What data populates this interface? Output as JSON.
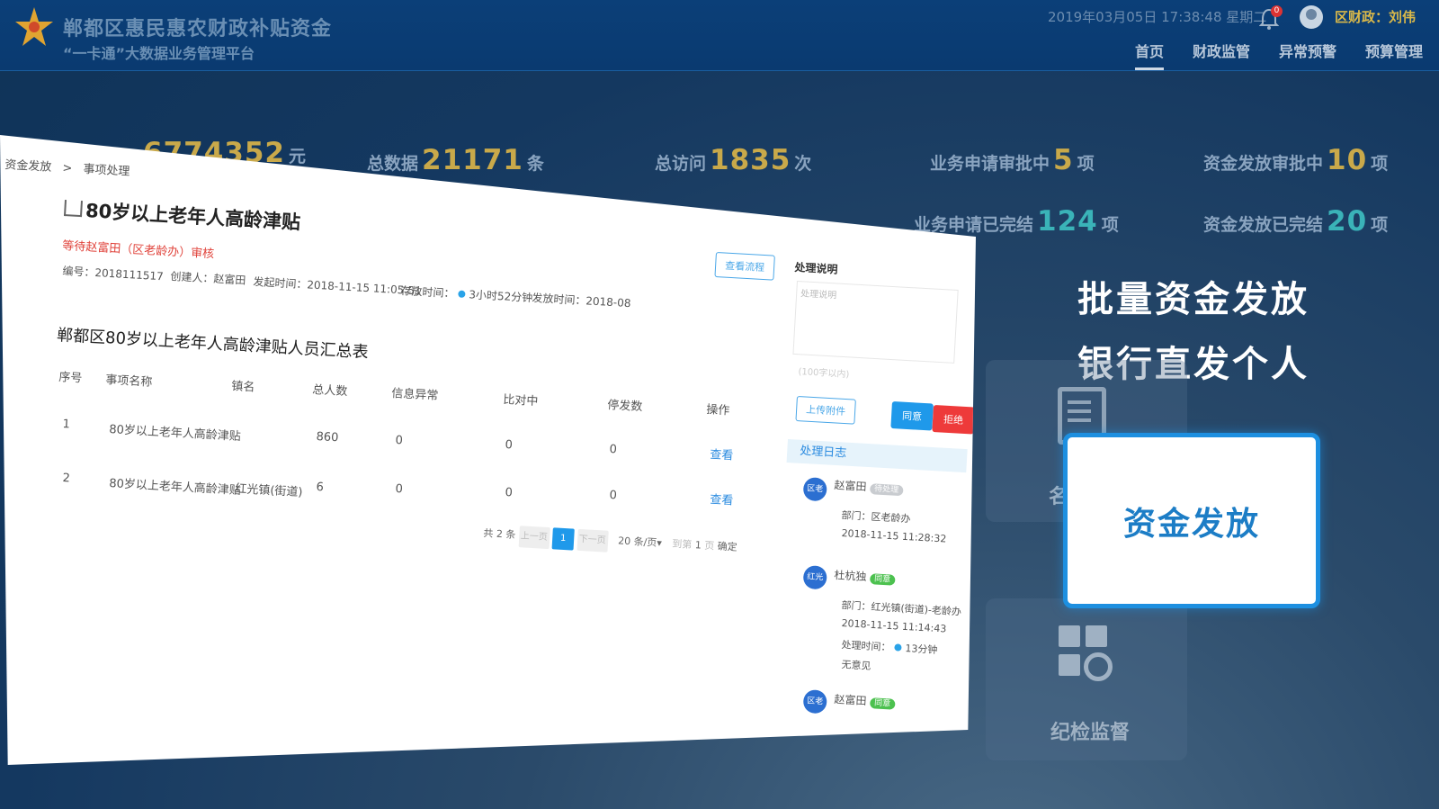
{
  "header": {
    "title_line1": "郸都区惠民惠农财政补贴资金",
    "title_line2": "“一卡通”大数据业务管理平台",
    "datetime": "2019年03月05日 17:38:48 星期二",
    "bell_count": "0",
    "user": "区财政：刘伟",
    "nav": [
      "首页",
      "财政监管",
      "异常预警",
      "预算管理"
    ]
  },
  "stats": {
    "total_data_label": "总数据",
    "total_data": "21171",
    "total_data_unit": "条",
    "visits_label": "总访问",
    "visits": "1835",
    "visits_unit": "次",
    "biz_pending_label": "业务申请审批中",
    "biz_pending": "5",
    "biz_pending_unit": "项",
    "fund_pending_label": "资金发放审批中",
    "fund_pending": "10",
    "fund_pending_unit": "项",
    "biz_done_label": "业务申请已完结",
    "biz_done": "124",
    "biz_done_unit": "项",
    "fund_done_label": "资金发放已完结",
    "fund_done": "20",
    "fund_done_unit": "项",
    "partial_amount": "6774352",
    "partial_unit": "元"
  },
  "promo": {
    "line1": "批量资金发放",
    "line2": "银行直发个人",
    "card": "资金发放",
    "ghost_label": "纪检监督",
    "ghost_side": "名"
  },
  "panel": {
    "breadcrumb": [
      "资金发放",
      ">",
      "事项处理"
    ],
    "title": "80岁以上老年人高龄津贴",
    "await": "等待赵富田（区老龄办）审核",
    "meta": {
      "number": "编号：2018111517",
      "creator": "创建人：赵富田",
      "start": "发起时间：2018-11-15 11:05:51",
      "stay_label": "存放时间：",
      "stay": "3小时52分钟",
      "issue": "发放时间：2018-08"
    },
    "view_flow": "查看流程",
    "table_title": "郸都区80岁以上老年人高龄津贴人员汇总表",
    "columns": [
      "序号",
      "事项名称",
      "镇名",
      "总人数",
      "信息异常",
      "比对中",
      "停发数",
      "操作"
    ],
    "rows": [
      [
        "1",
        "80岁以上老年人高龄津贴",
        "",
        "860",
        "0",
        "0",
        "0",
        "查看"
      ],
      [
        "2",
        "80岁以上老年人高龄津贴",
        "红光镇(街道)",
        "6",
        "0",
        "0",
        "0",
        "查看"
      ]
    ],
    "pager": {
      "total": "共 2 条",
      "prev": "上一页",
      "page": "1",
      "next": "下一页",
      "per_page": "20 条/页▾",
      "goto": "到第",
      "goto_val": "1",
      "page_unit": "页",
      "confirm": "确定"
    },
    "side": {
      "label": "处理说明",
      "placeholder": "处理说明",
      "limit": "(100字以内)",
      "upload": "上传附件",
      "approve": "同意",
      "reject": "拒绝",
      "log_title": "处理日志",
      "logs": [
        {
          "badge": "区老",
          "name": "赵富田",
          "tag": "待处理",
          "dept": "部门：区老龄办",
          "time": "2018-11-15 11:28:32"
        },
        {
          "badge": "红光",
          "name": "杜杭独",
          "tag": "同意",
          "dept": "部门：红光镇(街道)-老龄办",
          "time": "2018-11-15 11:14:43",
          "dur_label": "处理时间：",
          "dur": "13分钟",
          "note": "无意见"
        },
        {
          "badge": "区老",
          "name": "赵富田",
          "tag": "同意"
        }
      ]
    }
  }
}
